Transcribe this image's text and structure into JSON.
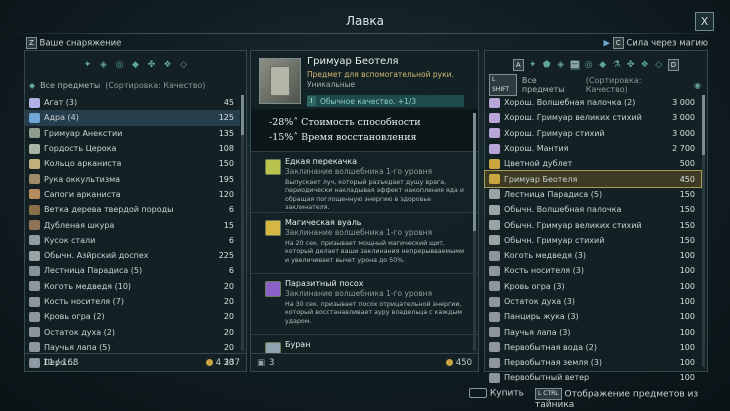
{
  "header": {
    "title": "Лавка",
    "close_key": "X"
  },
  "left_sub": {
    "key": "Z",
    "label": "Ваше снаряжение"
  },
  "right_sub": {
    "key": "C",
    "label": "Сила через магию"
  },
  "left_panel": {
    "filter_label": "Все предметы",
    "sort_label": "(Сортировка: Качество)",
    "items": [
      {
        "name": "Агат (3)",
        "value": "45",
        "icon_color": "#b3b0e6"
      },
      {
        "name": "Адра (4)",
        "value": "125",
        "icon_color": "#6fa6d6"
      },
      {
        "name": "Гримуар Анекстии",
        "value": "135",
        "icon_color": "#8e9b8f"
      },
      {
        "name": "Гордость Церока",
        "value": "108",
        "icon_color": "#a7b4a6"
      },
      {
        "name": "Кольцо арканиста",
        "value": "150",
        "icon_color": "#c0b07a"
      },
      {
        "name": "Рука оккультизма",
        "value": "195",
        "icon_color": "#9d8b6a"
      },
      {
        "name": "Сапоги арканиста",
        "value": "120",
        "icon_color": "#b28c5c"
      },
      {
        "name": "Ветка дерева твердой породы",
        "value": "6",
        "icon_color": "#8a6e4a"
      },
      {
        "name": "Дубленая шкура",
        "value": "15",
        "icon_color": "#8f7358"
      },
      {
        "name": "Кусок стали",
        "value": "6",
        "icon_color": "#8d9ea4"
      },
      {
        "name": "Обычн. Азйрский доспех",
        "value": "225",
        "icon_color": "#9aa4a6"
      },
      {
        "name": "Лестница Парадиса (5)",
        "value": "6",
        "icon_color": "#86939a"
      },
      {
        "name": "Коготь медведя (10)",
        "value": "20",
        "icon_color": "#8f959c"
      },
      {
        "name": "Кость носителя (7)",
        "value": "20",
        "icon_color": "#8f959c"
      },
      {
        "name": "Кровь огра (2)",
        "value": "20",
        "icon_color": "#8f959c"
      },
      {
        "name": "Остаток духа (2)",
        "value": "20",
        "icon_color": "#8f959c"
      },
      {
        "name": "Паучья лапа (5)",
        "value": "20",
        "icon_color": "#8f959c"
      },
      {
        "name": "Перо ...",
        "value": "20",
        "icon_color": "#8f959c"
      }
    ],
    "footer": {
      "count": "11 / 168",
      "gold": "4 337"
    }
  },
  "item_detail": {
    "name": "Гримуар Беотеля",
    "description": "Предмет для вспомогательной руки.",
    "rarity": "Уникальные",
    "quality_icon": "I",
    "quality": "Обычное качество. +1/3",
    "stats": [
      "-28%˄ Стоимость способности",
      "-15%˄ Время восстановления"
    ],
    "spells": [
      {
        "name": "Едкая перекачка",
        "subtitle": "Заклинание волшебника 1-го уровня",
        "description": "Выпускает луч, который разъедает душу врага, периодически накладывая эффект накопления яда и обращая поглощенную энергию в здоровье заклинателя.",
        "icon_color": "#b9c24b"
      },
      {
        "name": "Магическая вуаль",
        "subtitle": "Заклинание волшебника 1-го уровня",
        "description": "На 20 сек. призывает мощный магический щит, который делает ваши заклинания непрерывваемыми и увеличивает вычет урона до 50%.",
        "icon_color": "#d7b744"
      },
      {
        "name": "Паразитный посох",
        "subtitle": "Заклинание волшебника 1-го уровня",
        "description": "На 30 сек. призывает посох отрицательной энергии, который восстанавливает ауру владельца с каждым ударом.",
        "icon_color": "#8b5fc8"
      },
      {
        "name": "Буран",
        "subtitle": "",
        "description": "",
        "icon_color": "#8fa2ad"
      }
    ],
    "footer": {
      "quantity": "3",
      "price": "450"
    }
  },
  "right_panel": {
    "shift_key": "L SHIFT",
    "filter_label": "Все предметы",
    "sort_label": "(Сортировка: Качество)",
    "tab_key_left": "A",
    "tab_key_right": "D",
    "items": [
      {
        "name": "Хорош. Волшебная палочка (2)",
        "value": "3 000",
        "icon_color": "#b8a6d8",
        "style": "normal"
      },
      {
        "name": "Хорош. Гримуар великих стихий",
        "value": "3 000",
        "icon_color": "#b8a6d8",
        "style": "normal"
      },
      {
        "name": "Хорош. Гримуар стихий",
        "value": "3 000",
        "icon_color": "#b8a6d8",
        "style": "normal"
      },
      {
        "name": "Хорош. Мантия",
        "value": "2 700",
        "icon_color": "#b8a6d8",
        "style": "normal"
      },
      {
        "name": "Цветной дублет",
        "value": "500",
        "icon_color": "#c9a640",
        "style": "normal"
      },
      {
        "name": "Гримуар Беотеля",
        "value": "450",
        "icon_color": "#c9a640",
        "style": "gold"
      },
      {
        "name": "Лестница Парадиса (5)",
        "value": "150",
        "icon_color": "#9aa4a6",
        "style": "normal"
      },
      {
        "name": "Обычн. Волшебная палочка",
        "value": "150",
        "icon_color": "#9aa4a6",
        "style": "normal"
      },
      {
        "name": "Обычн. Гримуар великих стихий",
        "value": "150",
        "icon_color": "#9aa4a6",
        "style": "normal"
      },
      {
        "name": "Обычн. Гримуар стихий",
        "value": "150",
        "icon_color": "#9aa4a6",
        "style": "normal"
      },
      {
        "name": "Коготь медведя (3)",
        "value": "100",
        "icon_color": "#8f959c",
        "style": "normal"
      },
      {
        "name": "Кость носителя (3)",
        "value": "100",
        "icon_color": "#8f959c",
        "style": "normal"
      },
      {
        "name": "Кровь огра (3)",
        "value": "100",
        "icon_color": "#8f959c",
        "style": "normal"
      },
      {
        "name": "Остаток духа (3)",
        "value": "100",
        "icon_color": "#8f959c",
        "style": "normal"
      },
      {
        "name": "Панцирь жука (3)",
        "value": "100",
        "icon_color": "#8f959c",
        "style": "normal"
      },
      {
        "name": "Паучья лапа (3)",
        "value": "100",
        "icon_color": "#8f959c",
        "style": "normal"
      },
      {
        "name": "Первобытная вода (2)",
        "value": "100",
        "icon_color": "#8f959c",
        "style": "normal"
      },
      {
        "name": "Первобытная земля (3)",
        "value": "100",
        "icon_color": "#8f959c",
        "style": "normal"
      },
      {
        "name": "Первобытный ветер",
        "value": "100",
        "icon_color": "#8f959c",
        "style": "normal"
      }
    ]
  },
  "bottom": {
    "buy_label": "Купить",
    "stash_key": "L CTRL",
    "stash_label": "Отображение предметов из тайника"
  }
}
